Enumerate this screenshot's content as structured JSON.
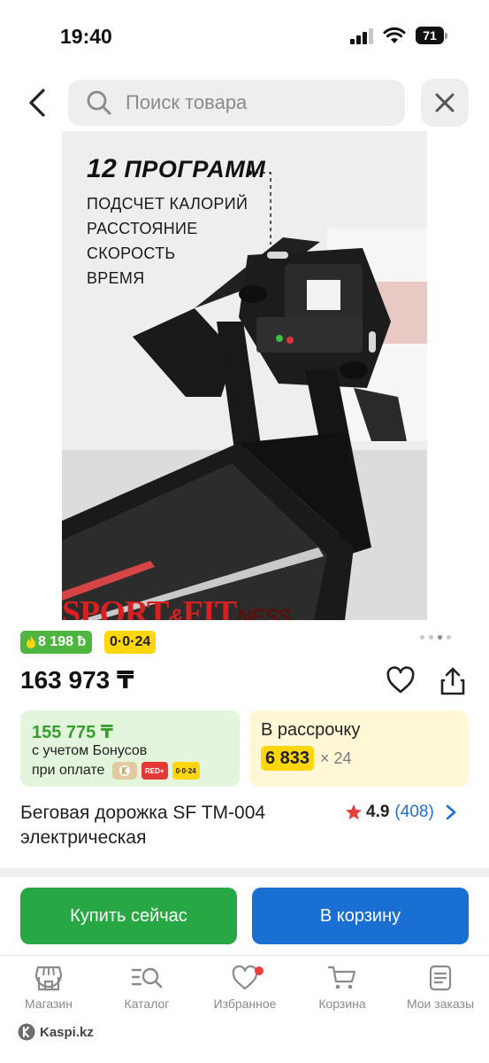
{
  "status_bar": {
    "time": "19:40",
    "battery": "71"
  },
  "search": {
    "placeholder": "Поиск товара"
  },
  "image": {
    "headline_number": "12",
    "headline_text": "ПРОГРАММ",
    "features": [
      "ПОДСЧЕТ КАЛОРИЙ",
      "РАССТОЯНИЕ",
      "СКОРОСТЬ",
      "ВРЕМЯ"
    ],
    "brand_main": "SPORT",
    "brand_amp": "&",
    "brand_fit": "FIT",
    "brand_ness": "NESS",
    "dots_total": 4,
    "dots_active_index": 2
  },
  "badges": {
    "bonus": "8 198 ƀ",
    "installment": "0·0·24"
  },
  "price": "163 973 ₸",
  "bonus_card": {
    "amount": "155 775 ₸",
    "line1": "с учетом Бонусов",
    "line2": "при оплате",
    "red_label": "RED+",
    "yellow_label": "0·0·24"
  },
  "credit_card": {
    "title": "В рассрочку",
    "monthly": "6 833",
    "term": "× 24"
  },
  "product": {
    "title_line1": "Беговая дорожка SF TM-004",
    "title_line2": "электрическая"
  },
  "rating": {
    "score": "4.9",
    "count": "(408)"
  },
  "actions": {
    "buy": "Купить сейчас",
    "cart": "В корзину"
  },
  "nav": {
    "shop": "Магазин",
    "catalog": "Каталог",
    "favorites": "Избранное",
    "cart": "Корзина",
    "orders": "Мои заказы"
  },
  "url": "Kaspi.kz",
  "colors": {
    "green": "#27a844",
    "blue": "#1a6fd2",
    "yellow": "#ffd60a",
    "red": "#ef3e3e"
  }
}
